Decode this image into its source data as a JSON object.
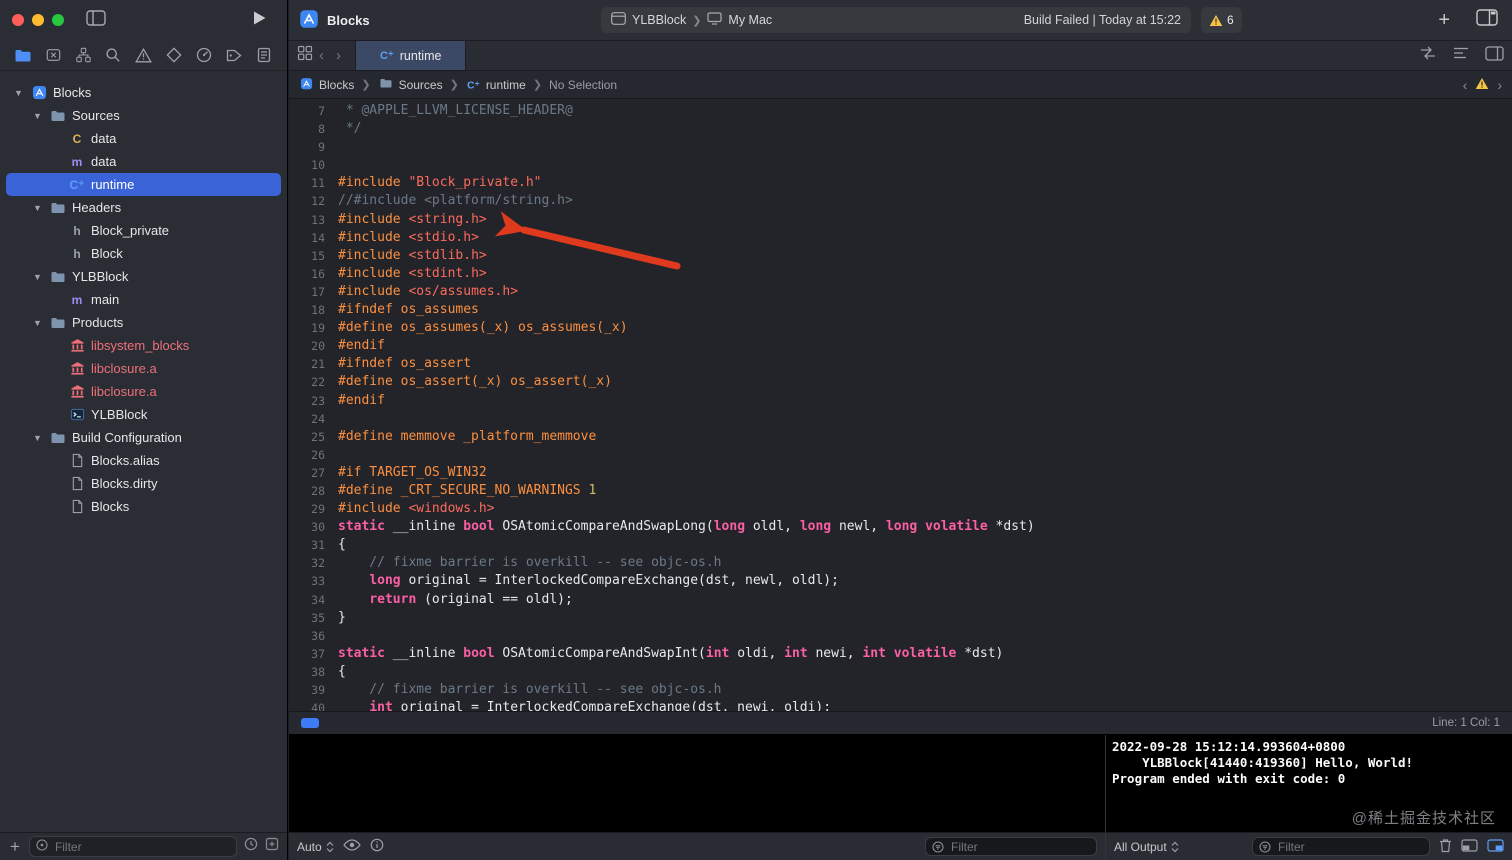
{
  "toolbar": {
    "project_title": "Blocks",
    "scheme": "YLBBlock",
    "destination": "My Mac",
    "status": "Build Failed | Today at 15:22",
    "warning_count": "6"
  },
  "tabs": {
    "active_tab": "runtime"
  },
  "jumpbar": {
    "items": [
      {
        "icon": "app",
        "label": "Blocks"
      },
      {
        "icon": "folder",
        "label": "Sources"
      },
      {
        "icon": "cpp",
        "label": "runtime"
      },
      {
        "icon": null,
        "label": "No Selection"
      }
    ]
  },
  "navigator": {
    "strip": [
      {
        "name": "project-navigator-icon",
        "icon": "folder-nav",
        "active": true
      },
      {
        "name": "source-control-navigator-icon",
        "icon": "xsquare",
        "active": false
      },
      {
        "name": "symbol-navigator-icon",
        "icon": "hierarchy",
        "active": false
      },
      {
        "name": "find-navigator-icon",
        "icon": "magnifier",
        "active": false
      },
      {
        "name": "issue-navigator-icon",
        "icon": "warning-outline",
        "active": false
      },
      {
        "name": "test-navigator-icon",
        "icon": "diamond",
        "active": false
      },
      {
        "name": "debug-navigator-icon",
        "icon": "gauge",
        "active": false
      },
      {
        "name": "breakpoint-navigator-icon",
        "icon": "tag",
        "active": false
      },
      {
        "name": "report-navigator-icon",
        "icon": "report",
        "active": false
      }
    ],
    "items": [
      {
        "depth": 0,
        "disclosure": true,
        "icon": "app",
        "label": "Blocks"
      },
      {
        "depth": 1,
        "disclosure": true,
        "icon": "folder",
        "label": "Sources"
      },
      {
        "depth": 2,
        "disclosure": false,
        "icon": "c",
        "label": "data"
      },
      {
        "depth": 2,
        "disclosure": false,
        "icon": "m",
        "label": "data"
      },
      {
        "depth": 2,
        "disclosure": false,
        "icon": "cpp",
        "label": "runtime",
        "selected": true
      },
      {
        "depth": 1,
        "disclosure": true,
        "icon": "folder",
        "label": "Headers"
      },
      {
        "depth": 2,
        "disclosure": false,
        "icon": "h",
        "label": "Block_private"
      },
      {
        "depth": 2,
        "disclosure": false,
        "icon": "h",
        "label": "Block"
      },
      {
        "depth": 1,
        "disclosure": true,
        "icon": "folder",
        "label": "YLBBlock"
      },
      {
        "depth": 2,
        "disclosure": false,
        "icon": "m",
        "label": "main"
      },
      {
        "depth": 1,
        "disclosure": true,
        "icon": "folder",
        "label": "Products"
      },
      {
        "depth": 2,
        "disclosure": false,
        "icon": "lib",
        "label": "libsystem_blocks",
        "red": true
      },
      {
        "depth": 2,
        "disclosure": false,
        "icon": "lib",
        "label": "libclosure.a",
        "red": true
      },
      {
        "depth": 2,
        "disclosure": false,
        "icon": "lib",
        "label": "libclosure.a",
        "red": true
      },
      {
        "depth": 2,
        "disclosure": false,
        "icon": "exec",
        "label": "YLBBlock"
      },
      {
        "depth": 1,
        "disclosure": true,
        "icon": "folder",
        "label": "Build Configuration"
      },
      {
        "depth": 2,
        "disclosure": false,
        "icon": "doc",
        "label": "Blocks.alias"
      },
      {
        "depth": 2,
        "disclosure": false,
        "icon": "doc",
        "label": "Blocks.dirty"
      },
      {
        "depth": 2,
        "disclosure": false,
        "icon": "doc",
        "label": "Blocks"
      }
    ],
    "filter_placeholder": "Filter"
  },
  "editor": {
    "lines": [
      {
        "n": 7,
        "t": [
          [
            "cmt",
            " * @APPLE_LLVM_LICENSE_HEADER@"
          ]
        ]
      },
      {
        "n": 8,
        "t": [
          [
            "cmt",
            " */"
          ]
        ]
      },
      {
        "n": 9,
        "t": []
      },
      {
        "n": 10,
        "t": []
      },
      {
        "n": 11,
        "t": [
          [
            "pre",
            "#include"
          ],
          [
            "plain",
            " "
          ],
          [
            "str",
            "\"Block_private.h\""
          ]
        ]
      },
      {
        "n": 12,
        "t": [
          [
            "cmt",
            "//#include <platform/string.h>"
          ]
        ]
      },
      {
        "n": 13,
        "t": [
          [
            "pre",
            "#include"
          ],
          [
            "plain",
            " "
          ],
          [
            "str",
            "<string.h>"
          ]
        ]
      },
      {
        "n": 14,
        "t": [
          [
            "pre",
            "#include"
          ],
          [
            "plain",
            " "
          ],
          [
            "str",
            "<stdio.h>"
          ]
        ]
      },
      {
        "n": 15,
        "t": [
          [
            "pre",
            "#include"
          ],
          [
            "plain",
            " "
          ],
          [
            "str",
            "<stdlib.h>"
          ]
        ]
      },
      {
        "n": 16,
        "t": [
          [
            "pre",
            "#include"
          ],
          [
            "plain",
            " "
          ],
          [
            "str",
            "<stdint.h>"
          ]
        ]
      },
      {
        "n": 17,
        "t": [
          [
            "pre",
            "#include"
          ],
          [
            "plain",
            " "
          ],
          [
            "str",
            "<os/assumes.h>"
          ]
        ]
      },
      {
        "n": 18,
        "t": [
          [
            "pre",
            "#ifndef os_assumes"
          ]
        ]
      },
      {
        "n": 19,
        "t": [
          [
            "pre",
            "#define os_assumes(_x) os_assumes(_x)"
          ]
        ]
      },
      {
        "n": 20,
        "t": [
          [
            "pre",
            "#endif"
          ]
        ]
      },
      {
        "n": 21,
        "t": [
          [
            "pre",
            "#ifndef os_assert"
          ]
        ]
      },
      {
        "n": 22,
        "t": [
          [
            "pre",
            "#define os_assert(_x) os_assert(_x)"
          ]
        ]
      },
      {
        "n": 23,
        "t": [
          [
            "pre",
            "#endif"
          ]
        ]
      },
      {
        "n": 24,
        "t": []
      },
      {
        "n": 25,
        "t": [
          [
            "pre",
            "#define memmove _platform_memmove"
          ]
        ]
      },
      {
        "n": 26,
        "t": []
      },
      {
        "n": 27,
        "t": [
          [
            "pre",
            "#if TARGET_OS_WIN32"
          ]
        ]
      },
      {
        "n": 28,
        "t": [
          [
            "pre",
            "#define _CRT_SECURE_NO_WARNINGS "
          ],
          [
            "num",
            "1"
          ]
        ]
      },
      {
        "n": 29,
        "t": [
          [
            "pre",
            "#include"
          ],
          [
            "plain",
            " "
          ],
          [
            "str",
            "<windows.h>"
          ]
        ]
      },
      {
        "n": 30,
        "t": [
          [
            "kw",
            "static"
          ],
          [
            "plain",
            " __inline "
          ],
          [
            "kw",
            "bool"
          ],
          [
            "plain",
            " OSAtomicCompareAndSwapLong("
          ],
          [
            "kw",
            "long"
          ],
          [
            "plain",
            " oldl, "
          ],
          [
            "kw",
            "long"
          ],
          [
            "plain",
            " newl, "
          ],
          [
            "kw",
            "long"
          ],
          [
            "plain",
            " "
          ],
          [
            "kw",
            "volatile"
          ],
          [
            "plain",
            " *dst)"
          ]
        ]
      },
      {
        "n": 31,
        "t": [
          [
            "plain",
            "{"
          ]
        ]
      },
      {
        "n": 32,
        "t": [
          [
            "cmt",
            "    // fixme barrier is overkill -- see objc-os.h"
          ]
        ]
      },
      {
        "n": 33,
        "t": [
          [
            "plain",
            "    "
          ],
          [
            "kw",
            "long"
          ],
          [
            "plain",
            " original = InterlockedCompareExchange(dst, newl, oldl);"
          ]
        ]
      },
      {
        "n": 34,
        "t": [
          [
            "plain",
            "    "
          ],
          [
            "kw",
            "return"
          ],
          [
            "plain",
            " (original == oldl);"
          ]
        ]
      },
      {
        "n": 35,
        "t": [
          [
            "plain",
            "}"
          ]
        ]
      },
      {
        "n": 36,
        "t": []
      },
      {
        "n": 37,
        "t": [
          [
            "kw",
            "static"
          ],
          [
            "plain",
            " __inline "
          ],
          [
            "kw",
            "bool"
          ],
          [
            "plain",
            " OSAtomicCompareAndSwapInt("
          ],
          [
            "kw",
            "int"
          ],
          [
            "plain",
            " oldi, "
          ],
          [
            "kw",
            "int"
          ],
          [
            "plain",
            " newi, "
          ],
          [
            "kw",
            "int"
          ],
          [
            "plain",
            " "
          ],
          [
            "kw",
            "volatile"
          ],
          [
            "plain",
            " *dst)"
          ]
        ]
      },
      {
        "n": 38,
        "t": [
          [
            "plain",
            "{"
          ]
        ]
      },
      {
        "n": 39,
        "t": [
          [
            "cmt",
            "    // fixme barrier is overkill -- see objc-os.h"
          ]
        ]
      },
      {
        "n": 40,
        "t": [
          [
            "plain",
            "    "
          ],
          [
            "kw",
            "int"
          ],
          [
            "plain",
            " original = InterlockedCompareExchange(dst, newi, oldi);"
          ]
        ]
      }
    ]
  },
  "editor_status": {
    "line_col": "Line: 1  Col: 1"
  },
  "debug": {
    "variables_scope": "Auto",
    "console_scope": "All Output",
    "filter_placeholder": "Filter"
  },
  "console": {
    "lines": [
      "2022-09-28 15:12:14.993604+0800",
      "    YLBBlock[41440:419360] Hello, World!",
      "Program ended with exit code: 0"
    ],
    "watermark": "@稀土掘金技术社区"
  },
  "colors": {
    "accent_blue": "#3a63d8",
    "warning_yellow": "#f6c343",
    "error_red_arrow": "#e03a1e",
    "build_failed_text": "#d2d3d7"
  }
}
